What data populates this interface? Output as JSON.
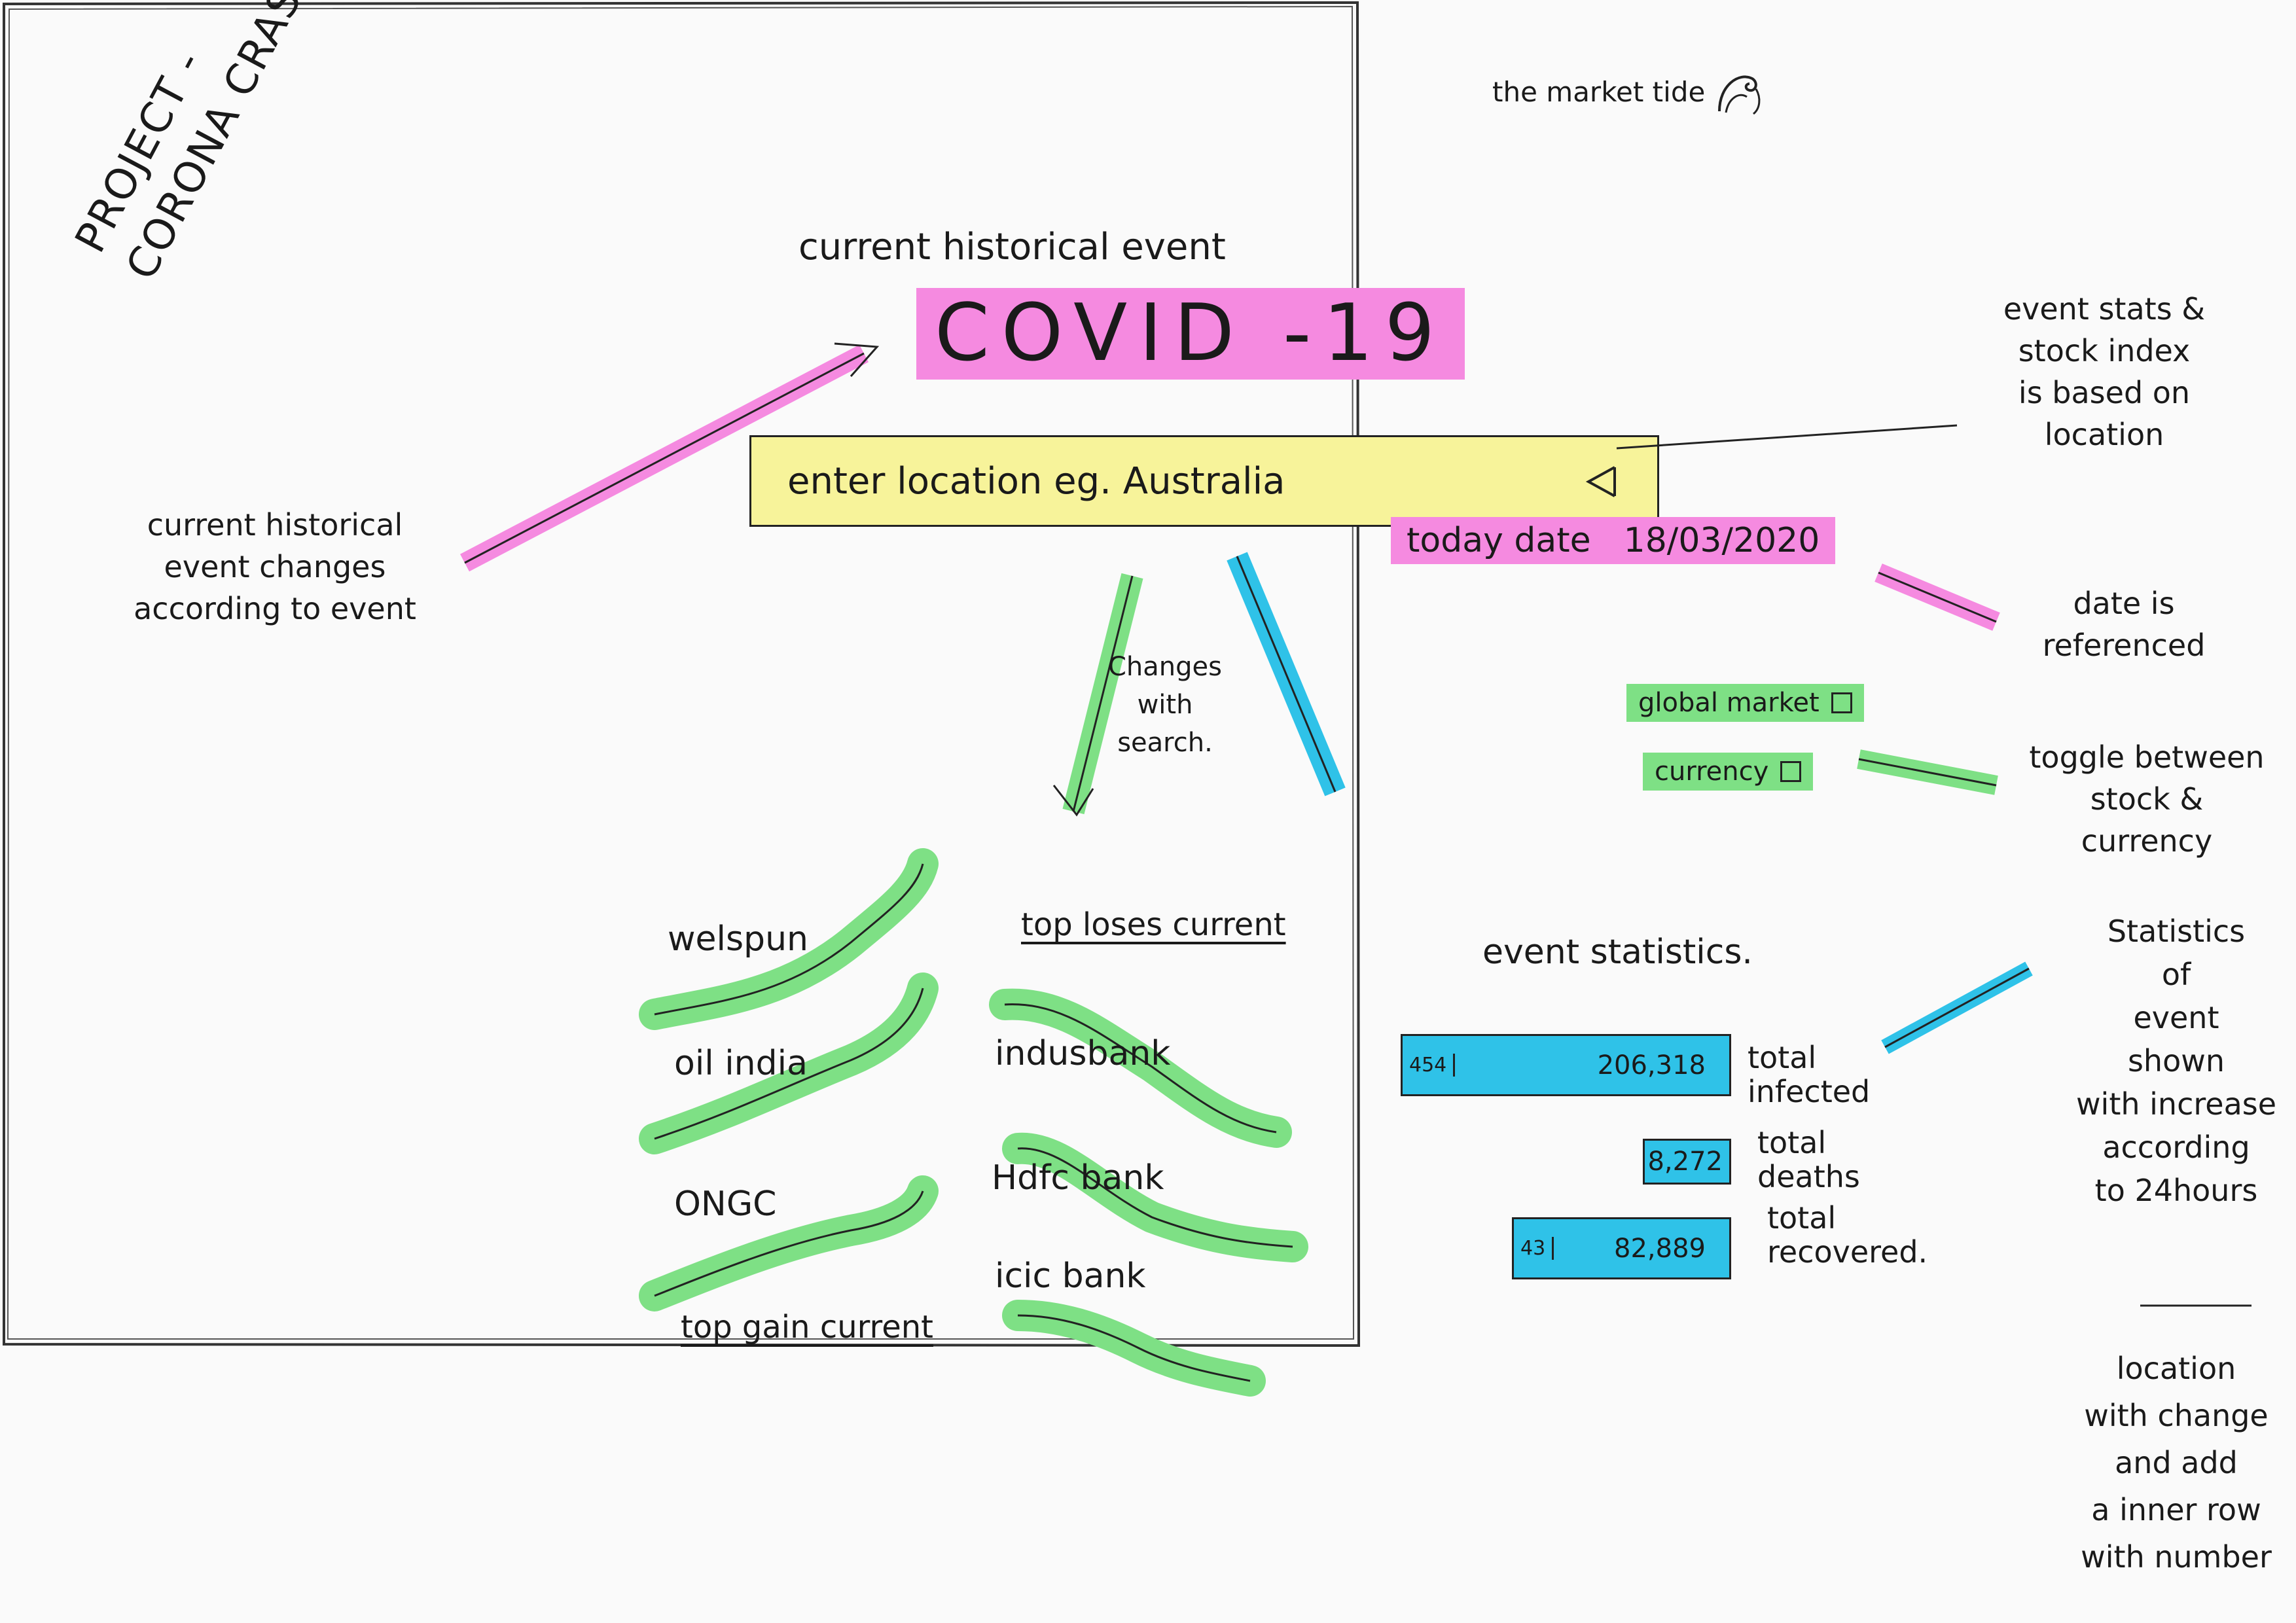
{
  "project": {
    "line1": "PROJECT -",
    "line2": "CORONA CRASH"
  },
  "brand": {
    "name": "the market tide"
  },
  "event": {
    "heading": "current historical event",
    "name": "COVID -19"
  },
  "search": {
    "placeholder": "enter location eg. Australia"
  },
  "date": {
    "label": "today date",
    "value": "18/03/2020"
  },
  "toggles": [
    {
      "label": "global market"
    },
    {
      "label": "currency"
    }
  ],
  "search_note": "Changes with search.",
  "top_gain": {
    "title": "top gain current",
    "items": [
      {
        "name": "welspun"
      },
      {
        "name": "oil india"
      },
      {
        "name": "ONGC"
      }
    ]
  },
  "top_loses": {
    "title": "top loses current",
    "items": [
      {
        "name": "indusbank"
      },
      {
        "name": "Hdfc bank"
      },
      {
        "name": "icic bank"
      }
    ]
  },
  "statistics": {
    "title": "event statistics.",
    "infected": {
      "delta": "454",
      "total": "206,318",
      "label1": "total",
      "label2": "infected"
    },
    "deaths": {
      "delta": "",
      "total": "8,272",
      "label1": "total",
      "label2": "deaths"
    },
    "recovered": {
      "delta": "43",
      "total": "82,889",
      "label1": "total",
      "label2": "recovered."
    }
  },
  "annotations": {
    "event_change": [
      "current historical",
      "event changes",
      "according to event"
    ],
    "location_based": [
      "event stats &",
      "stock index",
      "is based on",
      "location"
    ],
    "date_ref": [
      "date is",
      "referenced"
    ],
    "toggle_note": [
      "toggle between",
      "stock &",
      "currency"
    ],
    "stats_note": [
      "Statistics",
      "of",
      "event",
      "shown",
      "with increase",
      "according",
      "to 24hours"
    ],
    "location_note": [
      "location",
      "with change",
      "and add",
      "a inner row",
      "with number"
    ]
  },
  "colors": {
    "pink": "#f58ae0",
    "yellow": "#f7f39a",
    "green": "#7ee085",
    "blue": "#2fc2e8"
  }
}
